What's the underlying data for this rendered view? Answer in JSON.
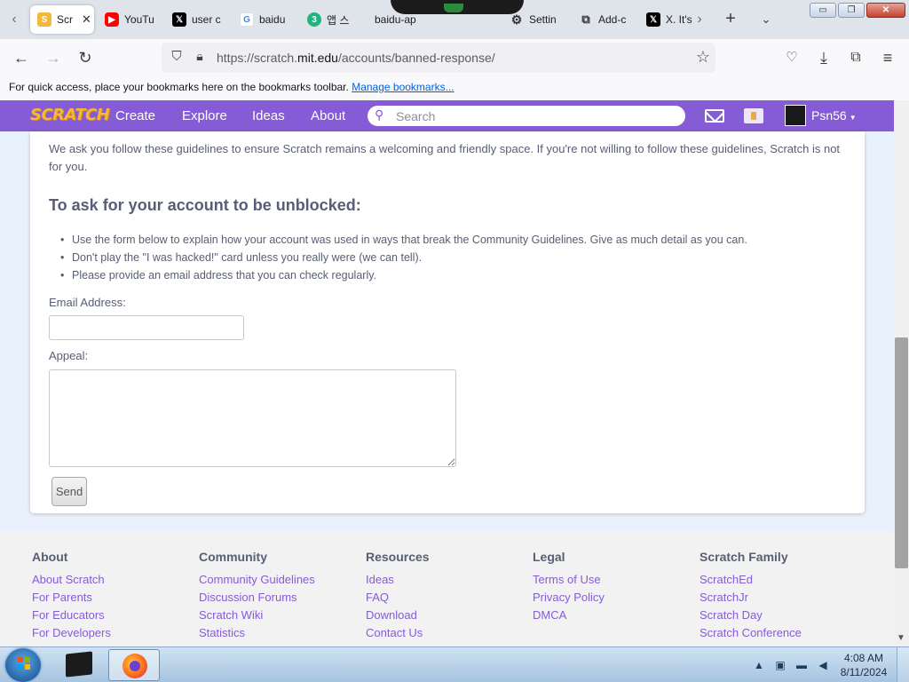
{
  "browser": {
    "tabs": [
      {
        "label": "Scr",
        "favicon": "scratch-favicon",
        "favicon_color": "#f6b738",
        "active": true
      },
      {
        "label": "YouTu",
        "favicon": "youtube-favicon",
        "favicon_color": "#ff0000"
      },
      {
        "label": "user c",
        "favicon": "x-favicon",
        "favicon_color": "#000000"
      },
      {
        "label": "baidu",
        "favicon": "google-favicon",
        "favicon_color": "#4285f4"
      },
      {
        "label": "앱 스",
        "favicon": "app-store-favicon",
        "favicon_color": "#1fb57f"
      },
      {
        "label": "baidu-ap",
        "favicon": "none",
        "favicon_color": ""
      },
      {
        "label": "Settin",
        "favicon": "gear-icon",
        "favicon_color": "#333333"
      },
      {
        "label": "Add-c",
        "favicon": "puzzle-icon",
        "favicon_color": "#333333"
      },
      {
        "label": "X. It's",
        "favicon": "x-favicon",
        "favicon_color": "#000000"
      }
    ],
    "tab_close_glyph": "✕",
    "new_tab_glyph": "+",
    "list_tabs_glyph": "⌄",
    "url_host_prefix": "https://scratch.",
    "url_host": "mit.edu",
    "url_path": "/accounts/banned-response/",
    "bookmarks_text": "For quick access, place your bookmarks here on the bookmarks toolbar.",
    "bookmarks_link": "Manage bookmarks..."
  },
  "scratch_nav": {
    "logo": "SCRATCH",
    "links": [
      "Create",
      "Explore",
      "Ideas",
      "About"
    ],
    "search_placeholder": "Search",
    "username": "Psn56"
  },
  "main": {
    "intro": "We ask you follow these guidelines to ensure Scratch remains a welcoming and friendly space. If you're not willing to follow these guidelines, Scratch is not for you.",
    "heading": "To ask for your account to be unblocked:",
    "rules": [
      "Use the form below to explain how your account was used in ways that break the Community Guidelines. Give as much detail as you can.",
      "Don't play the \"I was hacked!\" card unless you really were (we can tell).",
      "Please provide an email address that you can check regularly."
    ],
    "email_label": "Email Address:",
    "email_value": "",
    "appeal_label": "Appeal:",
    "appeal_value": "",
    "send_label": "Send"
  },
  "footer": {
    "columns": [
      {
        "title": "About",
        "links": [
          "About Scratch",
          "For Parents",
          "For Educators",
          "For Developers"
        ]
      },
      {
        "title": "Community",
        "links": [
          "Community Guidelines",
          "Discussion Forums",
          "Scratch Wiki",
          "Statistics"
        ]
      },
      {
        "title": "Resources",
        "links": [
          "Ideas",
          "FAQ",
          "Download",
          "Contact Us"
        ]
      },
      {
        "title": "Legal",
        "links": [
          "Terms of Use",
          "Privacy Policy",
          "DMCA"
        ]
      },
      {
        "title": "Scratch Family",
        "links": [
          "ScratchEd",
          "ScratchJr",
          "Scratch Day",
          "Scratch Conference"
        ]
      }
    ]
  },
  "taskbar": {
    "time": "4:08 AM",
    "date": "8/11/2024"
  },
  "colors": {
    "scratch_purple": "#855cd6",
    "scratch_text": "#575e75",
    "page_bg": "#e9f1fc"
  }
}
